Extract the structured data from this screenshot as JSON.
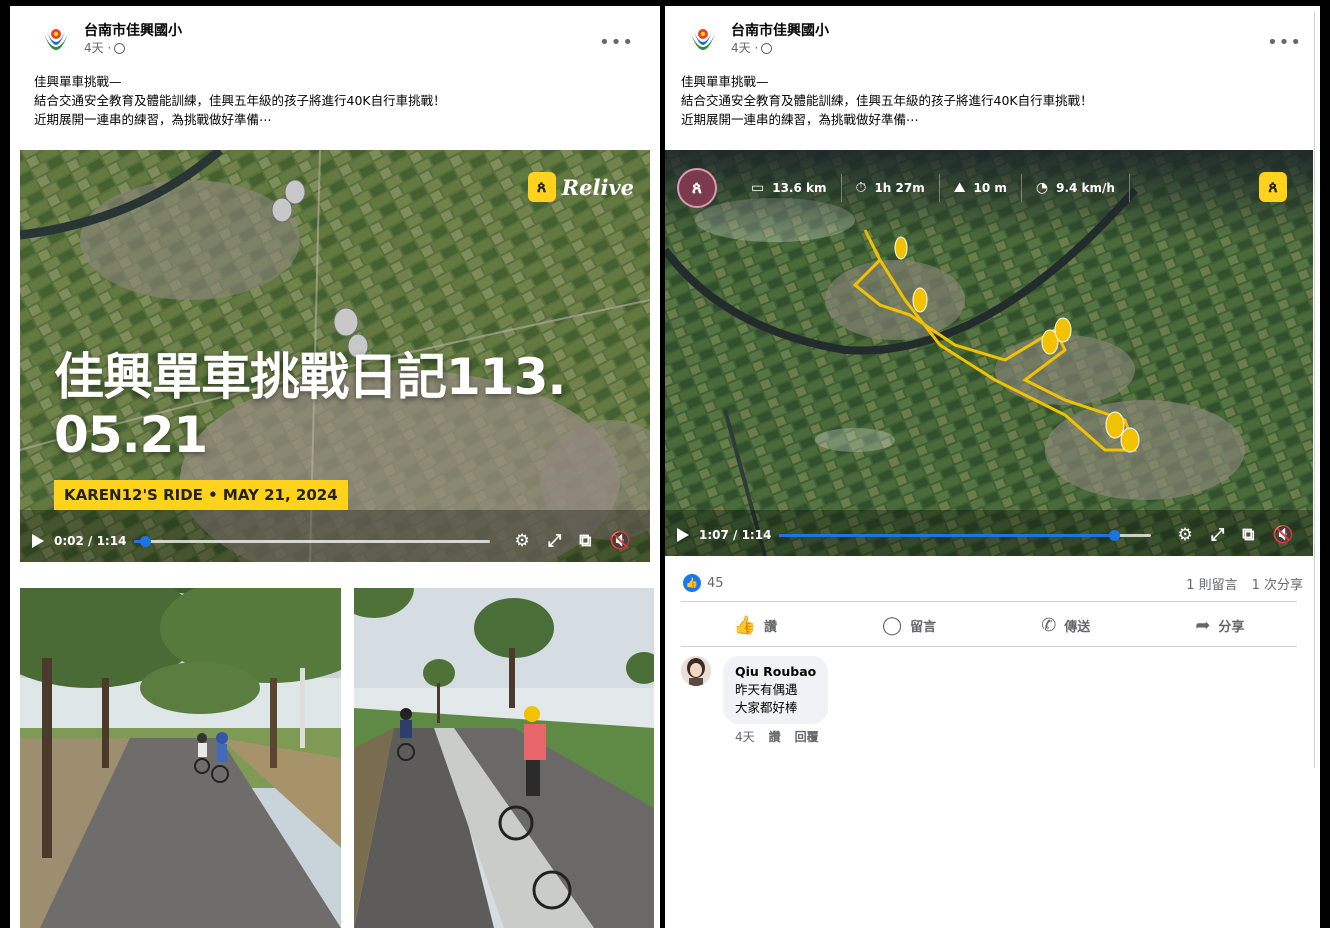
{
  "left_post": {
    "page_name": "台南市佳興國小",
    "time": "4天 ·",
    "more": "•••",
    "text": "佳興單車挑戰—\n結合交通安全教育及體能訓練，佳興五年級的孩子將進行40K自行車挑戰！\n近期展開一連串的練習，為挑戰做好準備⋯",
    "video": {
      "brand_badge": "ጰ",
      "brand_word": "Relive",
      "title_line1": "佳興單車挑戰日記113.",
      "title_line2": "05.21",
      "ride_banner": "KAREN12'S RIDE • MAY 21, 2024",
      "timecode": "0:02 / 1:14",
      "progress": 0.03
    }
  },
  "right_post": {
    "page_name": "台南市佳興國小",
    "time": "4天 ·",
    "more": "•••",
    "text": "佳興單車挑戰—\n結合交通安全教育及體能訓練，佳興五年級的孩子將進行40K自行車挑戰！\n近期展開一連串的練習，為挑戰做好準備⋯",
    "video": {
      "avatar_badge": "ጰ",
      "stats": [
        {
          "icon": "ruler-icon",
          "glyph": "▭",
          "value": "13.6 km"
        },
        {
          "icon": "stopwatch-icon",
          "glyph": "⏱",
          "value": "1h 27m"
        },
        {
          "icon": "mountain-icon",
          "glyph": "⛰",
          "value": "10 m"
        },
        {
          "icon": "speedometer-icon",
          "glyph": "◔",
          "value": "9.4 km/h"
        }
      ],
      "brand_badge": "ጰ",
      "timecode": "1:07 / 1:14",
      "progress": 0.9
    },
    "reactions": {
      "like_count": "45",
      "comments": "1 則留言",
      "shares": "1 次分享"
    },
    "actions": [
      {
        "label": "讚",
        "icon": "thumbs-up-icon",
        "glyph": "👍"
      },
      {
        "label": "留言",
        "icon": "comment-icon",
        "glyph": "◯"
      },
      {
        "label": "傳送",
        "icon": "whatsapp-icon",
        "glyph": "✆"
      },
      {
        "label": "分享",
        "icon": "share-icon",
        "glyph": "➦"
      }
    ],
    "comment": {
      "author": "Qiu Roubao",
      "line1": "昨天有偶遇",
      "line2": "大家都好棒",
      "time": "4天",
      "like": "讚",
      "reply": "回覆"
    }
  },
  "colors": {
    "accent": "#1877f2",
    "relive_yellow": "#ffd21e",
    "route_yellow": "#f2c200"
  }
}
